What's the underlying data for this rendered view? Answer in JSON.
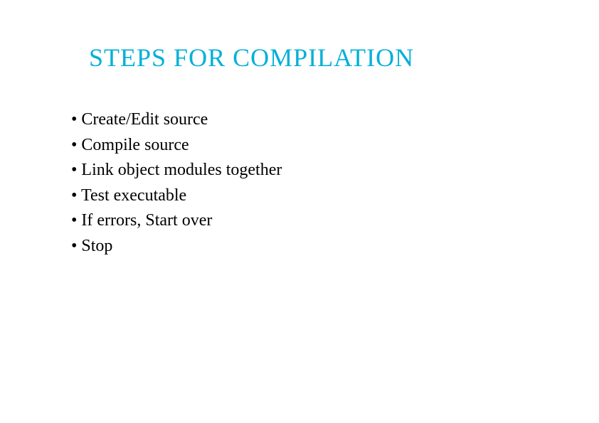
{
  "slide": {
    "title": "STEPS FOR COMPILATION",
    "bullets": [
      "Create/Edit  source",
      "Compile source",
      "Link object modules together",
      "Test executable",
      "If errors, Start over",
      "Stop"
    ]
  },
  "colors": {
    "title": "#00b0d8",
    "text": "#000000",
    "background": "#ffffff"
  }
}
